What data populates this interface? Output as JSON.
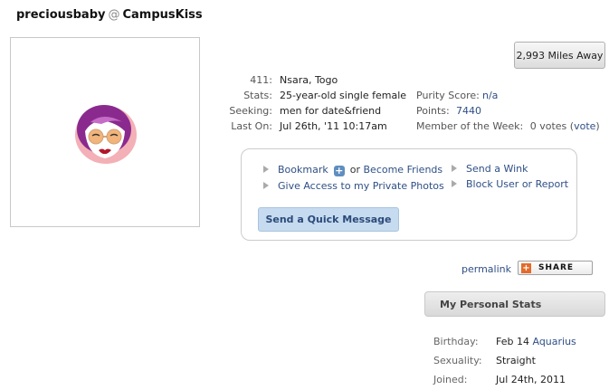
{
  "header": {
    "username": "preciousbaby",
    "at": "@",
    "site": "CampusKiss"
  },
  "distance_button": "2,993 Miles Away",
  "profile": {
    "f411_label": "411:",
    "f411_value": "Nsara, Togo",
    "stats_label": "Stats:",
    "stats_value": "25-year-old single female",
    "seeking_label": "Seeking:",
    "seeking_value": "men for date&friend",
    "laston_label": "Last On:",
    "laston_value": "Jul 26th, '11 10:17am",
    "purity_label": "Purity Score:",
    "purity_value": "n/a",
    "points_label": "Points:",
    "points_value": "7440",
    "motw_label": "Member of the Week:",
    "motw_value": "0 votes",
    "motw_vote_open": "(",
    "motw_vote": "vote",
    "motw_vote_close": ")"
  },
  "actions": {
    "bookmark": "Bookmark",
    "plus_icon": "plus-icon",
    "or": "or",
    "become_friends": "Become Friends",
    "private_photos": "Give Access to my Private Photos",
    "send_wink": "Send a Wink",
    "block_user": "Block User or Report",
    "quick_message": "Send a Quick Message"
  },
  "share": {
    "permalink": "permalink",
    "share_label": "SHARE",
    "share_icon_glyph": "+"
  },
  "personal_stats": {
    "title": "My Personal Stats",
    "birthday_label": "Birthday:",
    "birthday_value": "Feb 14",
    "birthday_sign": "Aquarius",
    "sexuality_label": "Sexuality:",
    "sexuality_value": "Straight",
    "joined_label": "Joined:",
    "joined_value": "Jul 24th, 2011"
  },
  "colors": {
    "link": "#2f4f86",
    "button_bg": "#c6dbef",
    "avatar_hair": "#8a2a8e",
    "avatar_glasses": "#f2b47a"
  }
}
